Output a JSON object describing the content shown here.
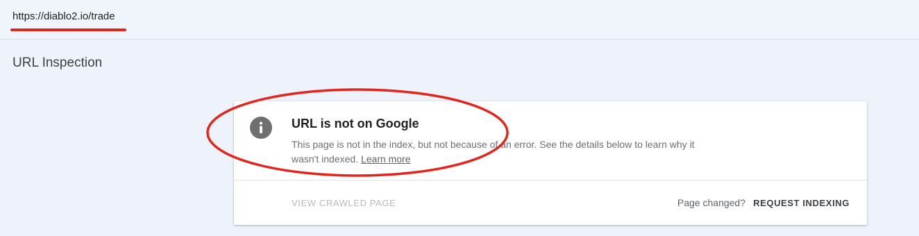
{
  "header": {
    "url": "https://diablo2.io/trade"
  },
  "page": {
    "title": "URL Inspection"
  },
  "status_card": {
    "icon": "info-icon",
    "title": "URL is not on Google",
    "description": "This page is not in the index, but not because of an error. See the details below to learn why it wasn't indexed.",
    "learn_more": "Learn more",
    "view_crawled_label": "VIEW CRAWLED PAGE",
    "page_changed_text": "Page changed?",
    "request_indexing_label": "REQUEST INDEXING"
  },
  "colors": {
    "annotation": "#e2261d",
    "info_icon_bg": "#6f6f6f",
    "background": "#eef2fa"
  }
}
